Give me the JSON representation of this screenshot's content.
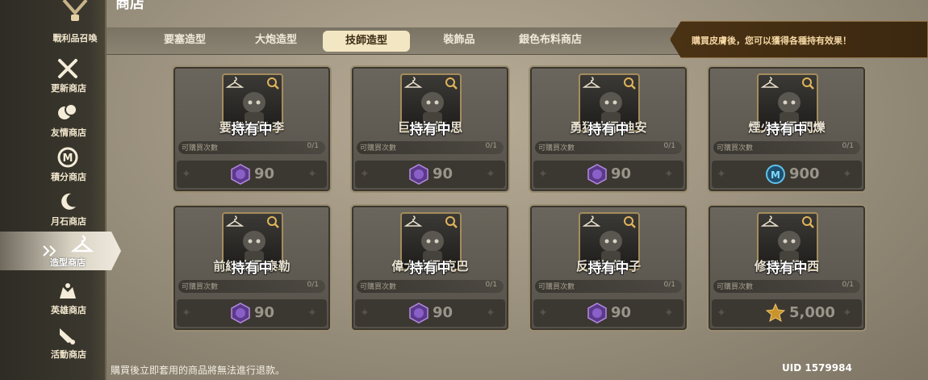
{
  "header": {
    "title": "商店"
  },
  "sidebar": {
    "top_label": "戰利品召喚",
    "items": [
      {
        "label": "更新商店",
        "icon": "swords-icon"
      },
      {
        "label": "友情商店",
        "icon": "friendship-icon"
      },
      {
        "label": "積分商店",
        "icon": "points-coin-icon"
      },
      {
        "label": "月石商店",
        "icon": "moon-icon"
      },
      {
        "label": "造型商店",
        "icon": "hanger-icon",
        "active": true
      },
      {
        "label": "英雄商店",
        "icon": "hero-icon"
      },
      {
        "label": "活動商店",
        "icon": "megaphone-icon"
      }
    ]
  },
  "tabs": [
    {
      "label": "要塞造型"
    },
    {
      "label": "大炮造型"
    },
    {
      "label": "技師造型",
      "active": true
    },
    {
      "label": "裝飾品"
    },
    {
      "label": "銀色布料商店"
    }
  ],
  "notice": "購買皮膚後，您可以獲得各種持有效果！",
  "owned_label": "持有中",
  "purchase_limit_label": "可購買次數",
  "cards": [
    {
      "name": "要塞技師 李",
      "limit": "0/1",
      "price": "90",
      "currency": "purple-gem-icon"
    },
    {
      "name": "巨人技師 思",
      "limit": "0/1",
      "price": "90",
      "currency": "purple-gem-icon"
    },
    {
      "name": "勇猛技師 迪安",
      "limit": "0/1",
      "price": "90",
      "currency": "purple-gem-icon"
    },
    {
      "name": "煙火技師 閃爍",
      "limit": "0/1",
      "price": "900",
      "currency": "mileage-coin-icon"
    },
    {
      "name": "前線技師 泰勒",
      "limit": "0/1",
      "price": "90",
      "currency": "purple-gem-icon"
    },
    {
      "name": "偉大技師 克巴",
      "limit": "0/1",
      "price": "90",
      "currency": "purple-gem-icon"
    },
    {
      "name": "反叛技師 子",
      "limit": "0/1",
      "price": "90",
      "currency": "purple-gem-icon"
    },
    {
      "name": "修理技師 西",
      "limit": "0/1",
      "price": "5,000",
      "currency": "medal-icon"
    }
  ],
  "footer": {
    "note": "購買後立即套用的商品將無法進行退款。",
    "uid": "UID 1579984"
  },
  "colors": {
    "notice_bg": "#3b2810",
    "active_tab": "#f3e6c2",
    "gem": "#7d4fb0",
    "mileage": "#3aa0c8"
  }
}
